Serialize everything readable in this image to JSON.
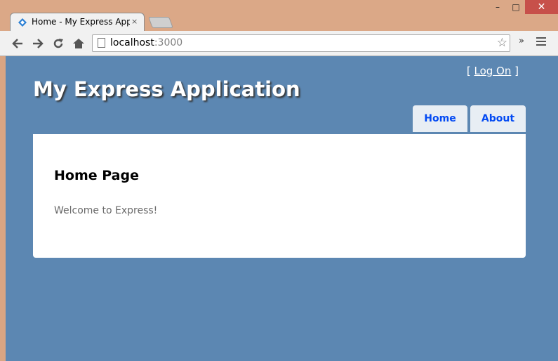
{
  "browser": {
    "tab_title": "Home - My Express Applic",
    "tab_close": "×",
    "url_host": "localhost",
    "url_port": ":3000",
    "overflow_chevron": "»",
    "window_minimize": "–",
    "window_maximize": "□",
    "window_close": "✕",
    "icons": {
      "back": "back-arrow-icon",
      "forward": "forward-arrow-icon",
      "reload": "reload-icon",
      "home": "home-icon",
      "star": "star-icon",
      "menu": "menu-icon"
    }
  },
  "site": {
    "logon_open": "[",
    "logon_link": "Log On",
    "logon_close": "]",
    "title": "My Express Application",
    "nav": [
      {
        "label": "Home"
      },
      {
        "label": "About"
      }
    ],
    "main": {
      "heading": "Home Page",
      "body": "Welcome to Express!"
    },
    "colors": {
      "background": "#5c87b2",
      "nav_tab": "#e8eef4",
      "nav_link": "#034af3",
      "content_bg": "#ffffff",
      "body_text": "#696969"
    }
  }
}
